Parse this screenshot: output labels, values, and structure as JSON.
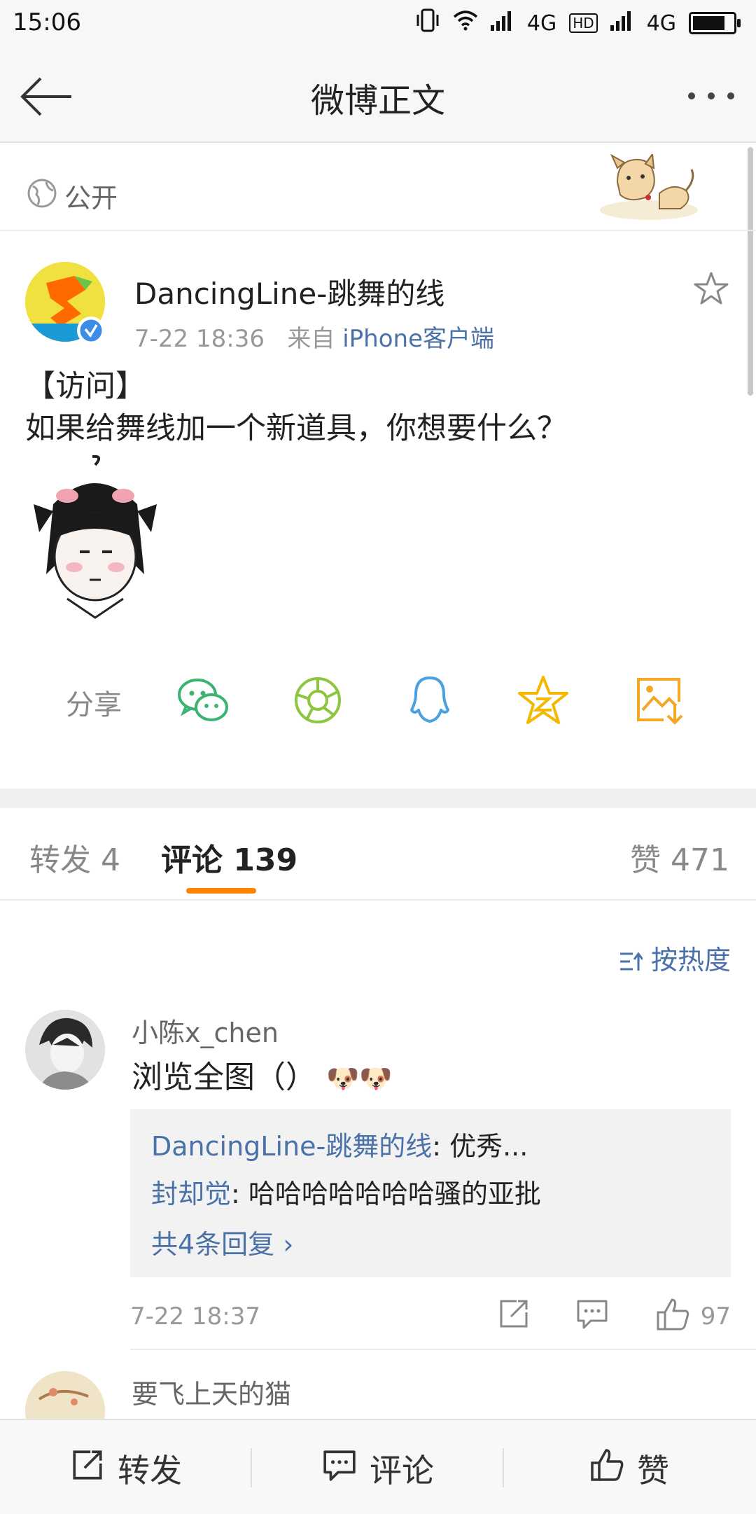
{
  "status_bar": {
    "time": "15:06",
    "network_1": "4G",
    "hd": "HD",
    "network_2": "4G",
    "battery_percent": 80
  },
  "nav": {
    "title": "微博正文",
    "more_label": "•••"
  },
  "visibility": {
    "label": "公开"
  },
  "post": {
    "author": "DancingLine-跳舞的线",
    "time": "7-22 18:36",
    "via": "来自",
    "source": "iPhone客户端",
    "text_line1": "【访问】",
    "text_line2": "如果给舞线加一个新道具，你想要什么？"
  },
  "share": {
    "label": "分享",
    "targets": [
      "wechat-icon",
      "moments-icon",
      "qq-icon",
      "qzone-icon",
      "save-image-icon"
    ]
  },
  "tabs": {
    "repost": "转发 4",
    "comments": "评论 139",
    "likes": "赞 471"
  },
  "sort": {
    "label": "按热度"
  },
  "comments": [
    {
      "name": "小陈x_chen",
      "text": "浏览全图（）",
      "emoji": "🐶🐶",
      "replies": [
        {
          "who": "DancingLine-跳舞的线",
          "text": ": 优秀..."
        },
        {
          "who": "封却觉",
          "text": ": 哈哈哈哈哈哈哈骚的亚批"
        }
      ],
      "more_replies": "共4条回复 ›",
      "time": "7-22 18:37",
      "likes": "97"
    },
    {
      "name": "要飞上天的猫"
    }
  ],
  "bottom_bar": {
    "repost": "转发",
    "comment": "评论",
    "like": "赞"
  },
  "colors": {
    "accent": "#ff8200",
    "link": "#4a72a8",
    "wechat": "#3cb371",
    "moments": "#8cc63f",
    "qq": "#4aa3df",
    "qzone": "#f5b800",
    "save": "#f5a623"
  }
}
